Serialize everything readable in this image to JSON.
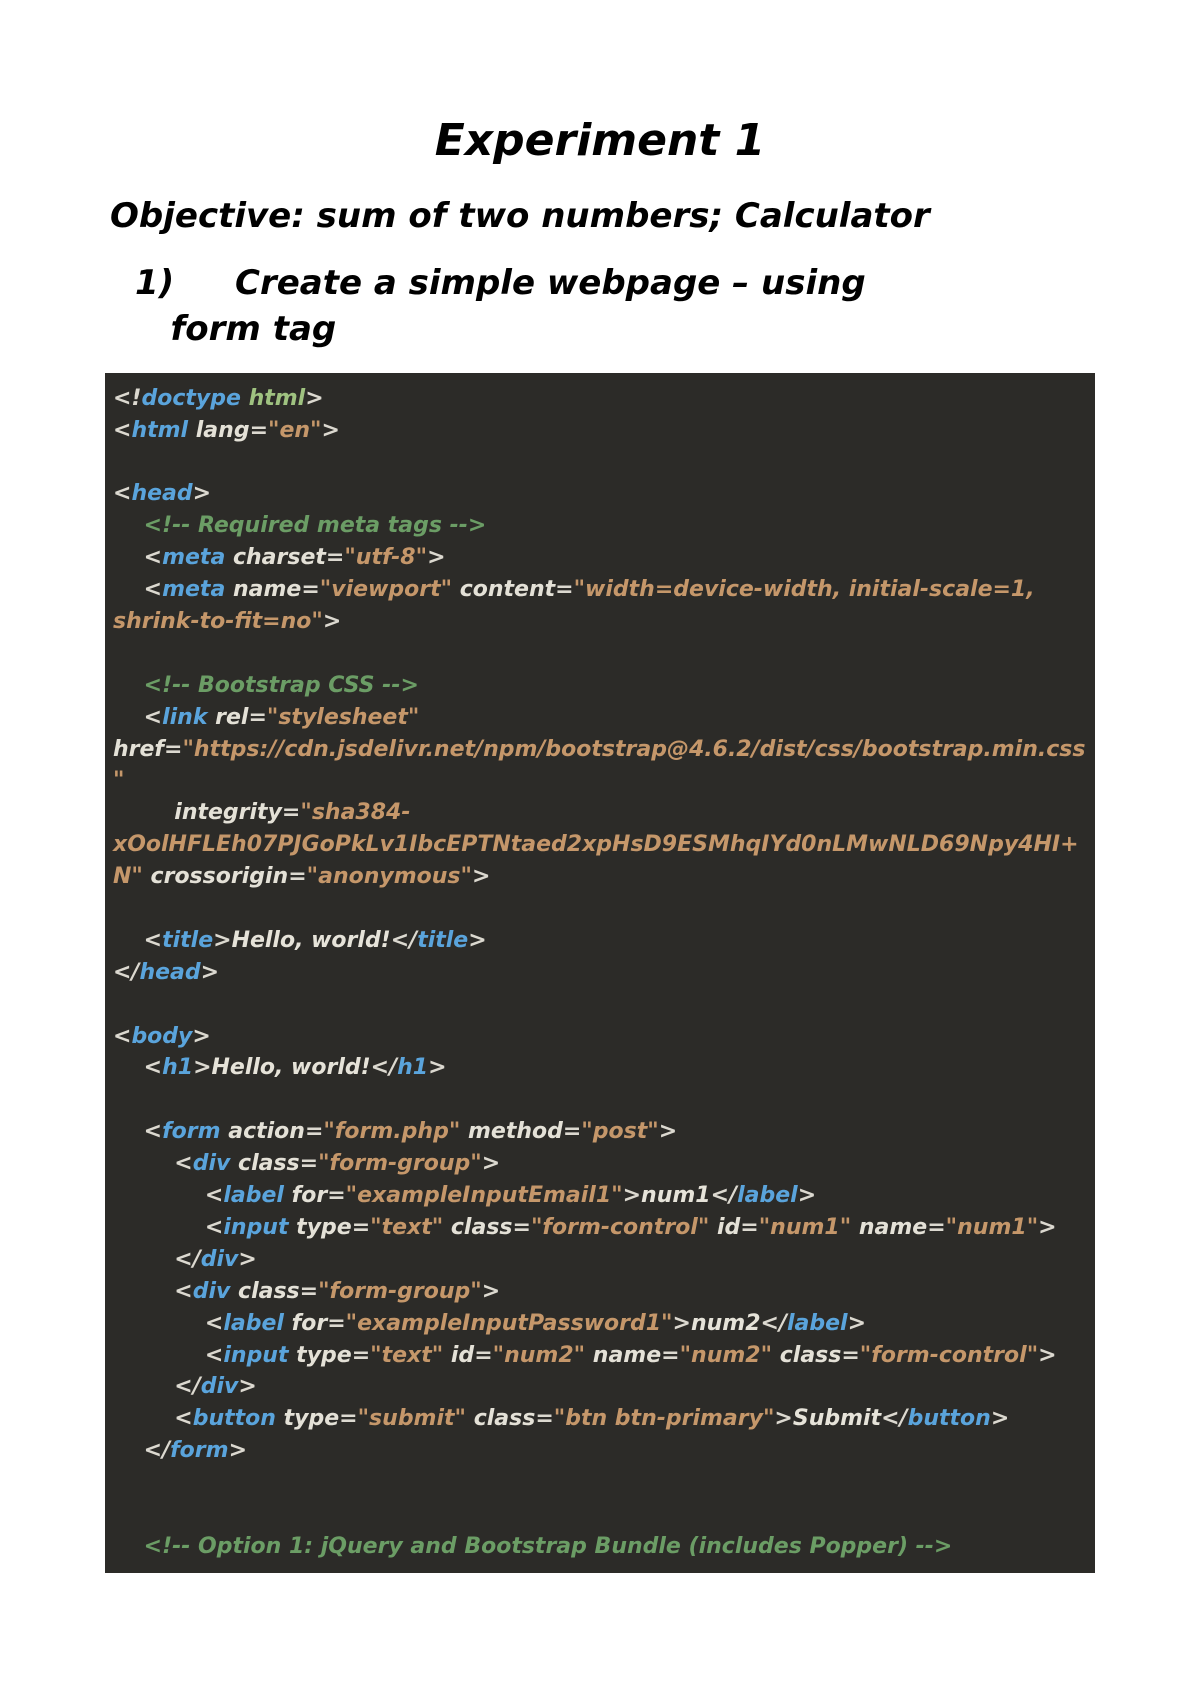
{
  "title": "Experiment 1",
  "objective": "Objective: sum of two numbers; Calculator",
  "step_num": "1)",
  "step_text_line1": "Create a simple webpage – using",
  "step_text_line2": "form tag",
  "code": {
    "l01": "<!doctype html>",
    "l02": "<html lang=\"en\">",
    "l03": "",
    "l04": "<head>",
    "l05": "    <!-- Required meta tags -->",
    "l06": "    <meta charset=\"utf-8\">",
    "l07": "    <meta name=\"viewport\" content=\"width=device-width, initial-scale=1, shrink-to-fit=no\">",
    "l08": "",
    "l09": "    <!-- Bootstrap CSS -->",
    "l10": "    <link rel=\"stylesheet\" href=\"https://cdn.jsdelivr.net/npm/bootstrap@4.6.2/dist/css/bootstrap.min.css\"",
    "l11": "        integrity=\"sha384-xOolHFLEh07PJGoPkLv1IbcEPTNtaed2xpHsD9ESMhqIYd0nLMwNLD69Npy4HI+N\" crossorigin=\"anonymous\">",
    "l12": "",
    "l13": "    <title>Hello, world!</title>",
    "l14": "</head>",
    "l15": "",
    "l16": "<body>",
    "l17": "    <h1>Hello, world!</h1>",
    "l18": "",
    "l19": "    <form action=\"form.php\" method=\"post\">",
    "l20": "        <div class=\"form-group\">",
    "l21": "            <label for=\"exampleInputEmail1\">num1</label>",
    "l22": "            <input type=\"text\" class=\"form-control\" id=\"num1\" name=\"num1\">",
    "l23": "        </div>",
    "l24": "        <div class=\"form-group\">",
    "l25": "            <label for=\"exampleInputPassword1\">num2</label>",
    "l26": "            <input type=\"text\" id=\"num2\" name=\"num2\" class=\"form-control\">",
    "l27": "        </div>",
    "l28": "        <button type=\"submit\" class=\"btn btn-primary\">Submit</button>",
    "l29": "    </form>",
    "l30": "",
    "l31": "",
    "l32": "    <!-- Option 1: jQuery and Bootstrap Bundle (includes Popper) -->"
  }
}
